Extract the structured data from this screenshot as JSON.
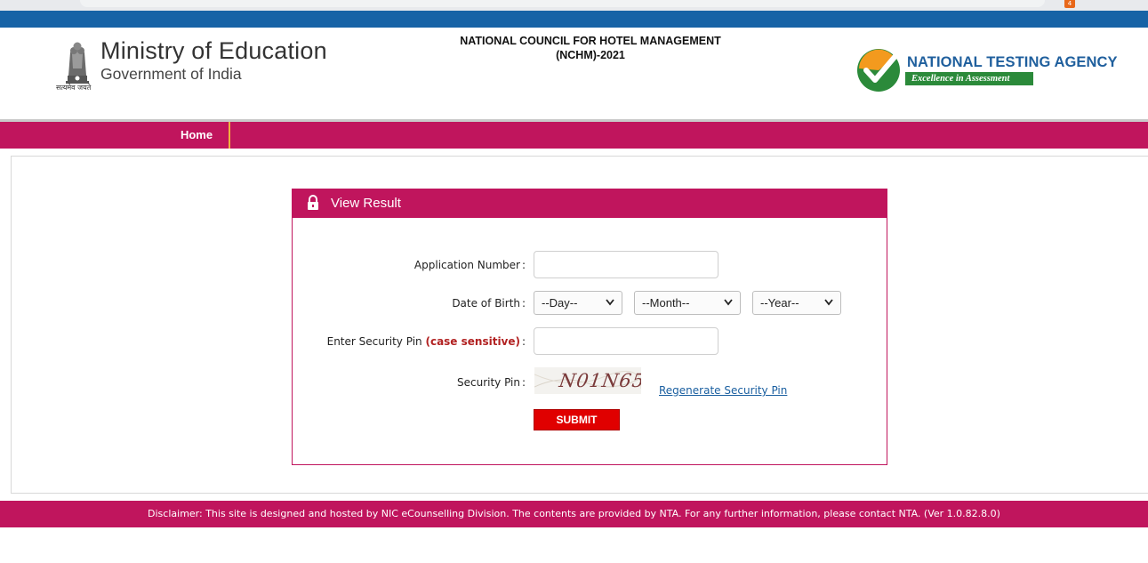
{
  "browser": {
    "extension_badge": "4"
  },
  "header": {
    "emblem_caption": "सत्यमेव जयते",
    "ministry": "Ministry of Education",
    "government": "Government of India",
    "council_line1": "NATIONAL COUNCIL FOR HOTEL MANAGEMENT",
    "council_line2": "(NCHM)-2021",
    "agency_name": "NATIONAL TESTING AGENCY",
    "agency_tagline": "Excellence in Assessment"
  },
  "nav": {
    "home": "Home"
  },
  "panel": {
    "title": "View Result",
    "application_label": "Application Number",
    "dob_label": "Date of Birth",
    "security_label": "Enter Security Pin",
    "security_label_note": "(case sensitive)",
    "captcha_label": "Security Pin",
    "colon": ":",
    "day_option": "--Day--",
    "month_option": "--Month--",
    "year_option": "--Year--",
    "application_value": "",
    "security_value": "",
    "captcha_text": "N01N65",
    "regenerate": "Regenerate Security Pin",
    "submit": "SUBMIT"
  },
  "footer": {
    "disclaimer": "Disclaimer: This site is designed and hosted by NIC eCounselling Division. The contents are provided by NTA. For any further information, please contact NTA. (Ver 1.0.82.8.0)"
  },
  "colors": {
    "brand_magenta": "#c0155d",
    "top_blue": "#1763a6",
    "submit_red": "#e00000",
    "agency_blue": "#1f5f9d",
    "agency_green": "#2b8a3a"
  },
  "icons": {
    "emblem": "national-emblem-icon",
    "agency_logo": "nta-checkmark-logo-icon",
    "panel": "lock-icon",
    "select": "chevron-down-icon"
  }
}
